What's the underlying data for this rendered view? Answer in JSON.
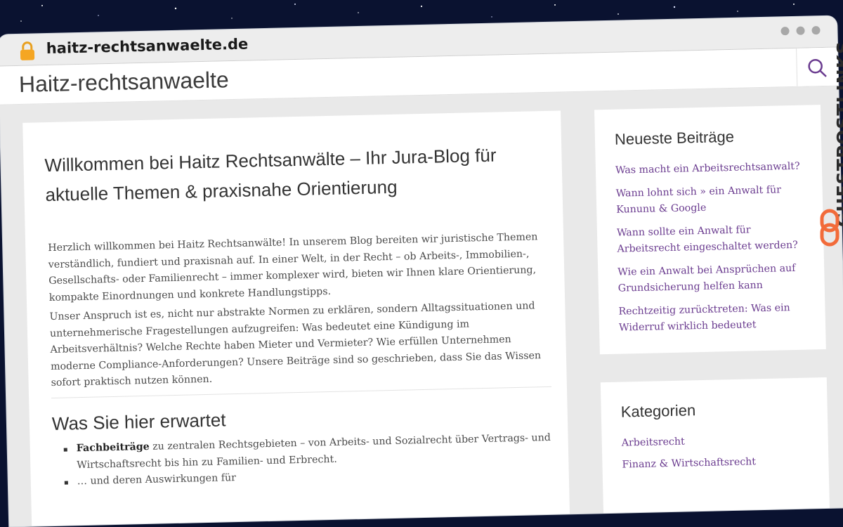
{
  "browser": {
    "url": "haitz-rechtsanwaelte.de",
    "lock_icon": "padlock-icon",
    "window_controls": [
      "dot",
      "dot",
      "dot"
    ]
  },
  "site": {
    "title": "Haitz-rechtsanwaelte",
    "search_icon": "search-icon"
  },
  "post": {
    "title": "Willkommen bei Haitz Rechtsanwälte – Ihr Jura-Blog für aktuelle Themen & praxisnahe Orientierung",
    "paragraph1": "Herzlich willkommen bei Haitz Rechtsanwälte! In unserem Blog bereiten wir juristische Themen verständlich, fundiert und praxisnah auf. In einer Welt, in der Recht – ob Arbeits-, Immobilien-, Gesellschafts- oder Familienrecht – immer komplexer wird, bieten wir Ihnen klare Orientierung, kompakte Einordnungen und konkrete Handlungstipps.",
    "paragraph2": "Unser Anspruch ist es, nicht nur abstrakte Normen zu erklären, sondern Alltagssituationen und unternehmerische Fragestellungen aufzugreifen: Was bedeutet eine Kündigung im Arbeitsverhältnis? Welche Rechte haben Mieter und Vermieter? Wie erfüllen Unternehmen moderne Compliance-Anforderungen? Unsere Beiträge sind so geschrieben, dass Sie das Wissen sofort praktisch nutzen können.",
    "section_heading": "Was Sie hier erwartet",
    "bullets": [
      {
        "bold": "Fachbeiträge",
        "text": " zu zentralen Rechtsgebieten – von Arbeits- und Sozialrecht über Vertrags- und Wirtschaftsrecht bis hin zu Familien- und Erbrecht."
      },
      {
        "bold": "",
        "text": "… und deren Auswirkungen für"
      }
    ]
  },
  "sidebar": {
    "recent_title": "Neueste Beiträge",
    "recent": [
      "Was macht ein Arbeitsrechtsanwalt?",
      "Wann lohnt sich » ein Anwalt für Kununu & Google",
      "Wann sollte ein Anwalt für Arbeitsrecht eingeschaltet werden?",
      "Wie ein Anwalt bei Ansprüchen auf Grundsicherung helfen kann",
      "Rechtzeitig zurücktreten: Was ein Widerruf wirklich bedeutet"
    ],
    "categories_title": "Kategorien",
    "categories": [
      "Arbeitsrecht",
      "Finanz & Wirtschaftsrecht"
    ]
  },
  "badge": {
    "text": "GUESTPOSTLINKS",
    "icon": "chain-link-icon"
  },
  "colors": {
    "link": "#6a3b8f",
    "badge_icon": "#f26b3a",
    "lock": "#f5a623"
  }
}
